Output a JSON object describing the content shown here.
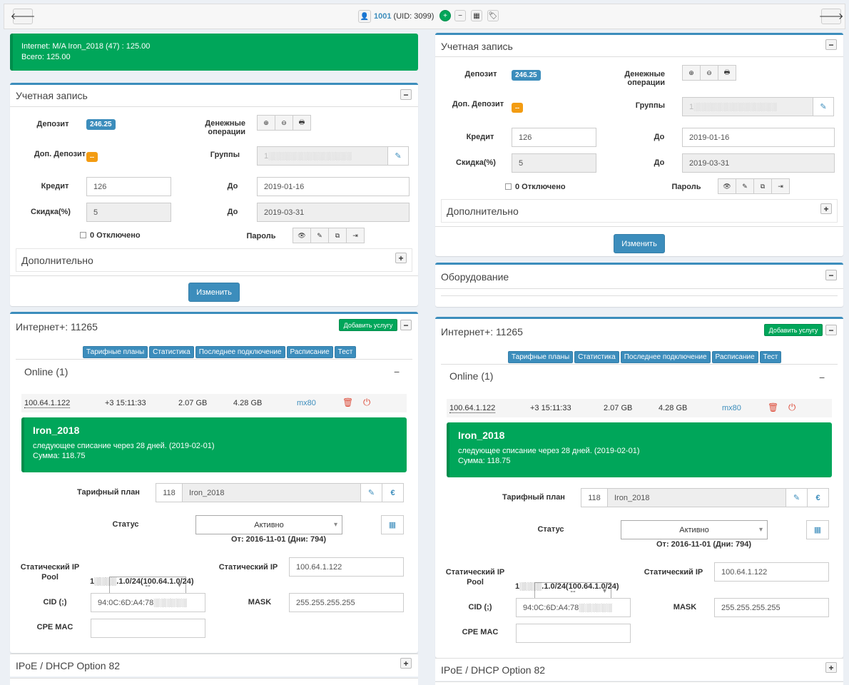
{
  "topbar": {
    "user_login": "1001",
    "uid_text": "(UID: 3099)",
    "back_icon": "arrow-left-icon",
    "forward_icon": "arrow-right-icon"
  },
  "alert": {
    "line1": "Internet: M/A Iron_2018 (47) : 125.00",
    "line2": "Всего: 125.00"
  },
  "account": {
    "title": "Учетная запись",
    "deposit_label": "Депозит",
    "deposit_value": "246.25",
    "money_ops_label": "Денежные операции",
    "ext_deposit_label": "Доп. Депозит",
    "ext_deposit_value": "--",
    "groups_label": "Группы",
    "groups_value": "1░░░░░░░░░░░░░░░",
    "credit_label": "Кредит",
    "credit_value": "126",
    "to_label": "До",
    "credit_to": "2019-01-16",
    "discount_label": "Скидка(%)",
    "discount_value": "5",
    "discount_to": "2019-03-31",
    "disabled_label": "0 Отключено",
    "password_label": "Пароль",
    "extra_label": "Дополнительно",
    "change_label": "Изменить"
  },
  "equipment": {
    "title": "Оборудование"
  },
  "internet": {
    "title": "Интернет+: 11265",
    "add_service": "Добавить услугу",
    "tabs": [
      "Тарифные планы",
      "Статистика",
      "Последнее подключение",
      "Расписание",
      "Тест"
    ],
    "online_title": "Online (1)",
    "session": {
      "ip": "100.64.1.122",
      "duration": "+3 15:11:33",
      "sent": "2.07 GB",
      "recv": "4.28 GB",
      "nas": "mx80"
    },
    "tariff_box": {
      "name": "Iron_2018",
      "next": "следующее списание через 28 дней. (2019-02-01)",
      "sum": "Сумма: 118.75"
    },
    "tp_label": "Тарифный план",
    "tp_id": "118",
    "tp_name": "Iron_2018",
    "status_label": "Статус",
    "status_value": "Активно",
    "status_since": "От: 2016-11-01 (Дни: 794)",
    "static_pool_label": "Статический IP Pool",
    "pool_value": "--",
    "pool_info": "1░░░░.1.0/24(100.64.1.0/24)",
    "static_ip_label": "Статический IP",
    "static_ip_value": "100.64.1.122",
    "cid_label": "CID (;)",
    "cid_value": "94:0C:6D:A4:78░░░░░░",
    "mask_label": "MASK",
    "mask_value": "255.255.255.255",
    "cpe_label": "CPE MAC",
    "cpe_value": ""
  },
  "ipoe": {
    "title": "IPoE / DHCP Option 82"
  },
  "colors": {
    "primary": "#3c8dbc",
    "success": "#00a65a",
    "warning": "#f39c12",
    "danger": "#dd4b39"
  }
}
